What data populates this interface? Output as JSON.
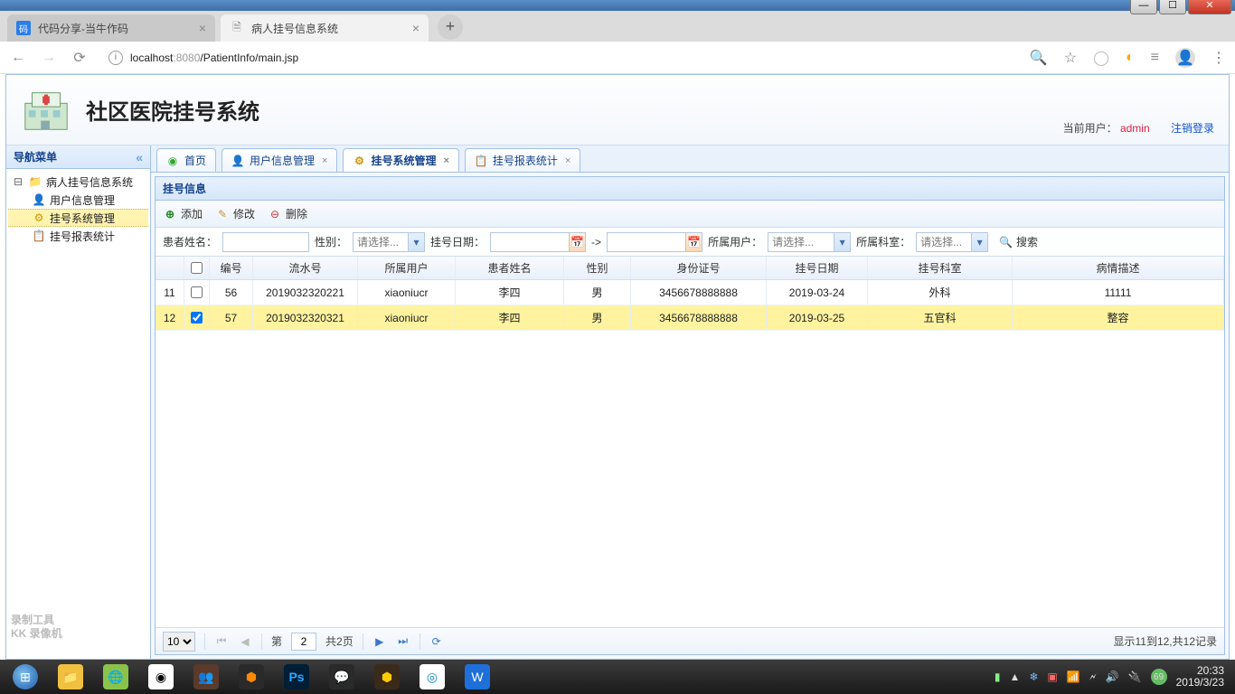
{
  "window": {
    "minimize": "—",
    "maximize": "☐",
    "close": "✕"
  },
  "browser": {
    "tabs": [
      {
        "title": "代码分享-当牛作码",
        "favicon_bg": "#2b7de9",
        "favicon_txt": "码",
        "active": false
      },
      {
        "title": "病人挂号信息系统",
        "favicon_bg": "#ffffff",
        "favicon_txt": "🗎",
        "active": true
      }
    ],
    "newtab": "+",
    "url_host": "localhost",
    "url_port": ":8080",
    "url_path": "/PatientInfo/main.jsp"
  },
  "header": {
    "title": "社区医院挂号系统",
    "current_user_label": "当前用户：",
    "current_user": "admin",
    "logout": "注销登录"
  },
  "sidebar": {
    "title": "导航菜单",
    "root": "病人挂号信息系统",
    "items": [
      {
        "label": "用户信息管理"
      },
      {
        "label": "挂号系统管理"
      },
      {
        "label": "挂号报表统计"
      }
    ]
  },
  "tabs": [
    {
      "label": "首页",
      "closable": false
    },
    {
      "label": "用户信息管理",
      "closable": true
    },
    {
      "label": "挂号系统管理",
      "closable": true,
      "active": true
    },
    {
      "label": "挂号报表统计",
      "closable": true
    }
  ],
  "panel": {
    "title": "挂号信息"
  },
  "toolbar": {
    "add": "添加",
    "edit": "修改",
    "del": "删除"
  },
  "search": {
    "name_label": "患者姓名：",
    "sex_label": "性别：",
    "sex_placeholder": "请选择...",
    "date_label": "挂号日期：",
    "date_sep": "->",
    "owner_label": "所属用户：",
    "owner_placeholder": "请选择...",
    "dept_label": "所属科室：",
    "dept_placeholder": "请选择...",
    "search_btn": "搜索"
  },
  "grid": {
    "headers": {
      "id": "编号",
      "serial": "流水号",
      "user": "所属用户",
      "name": "患者姓名",
      "sex": "性别",
      "idno": "身份证号",
      "date": "挂号日期",
      "dept": "挂号科室",
      "desc": "病情描述"
    },
    "rows": [
      {
        "rn": "11",
        "checked": false,
        "id": "56",
        "serial": "2019032320221",
        "user": "xiaoniucr",
        "name": "李四",
        "sex": "男",
        "idno": "3456678888888",
        "date": "2019-03-24",
        "dept": "外科",
        "desc": "11111"
      },
      {
        "rn": "12",
        "checked": true,
        "id": "57",
        "serial": "2019032320321",
        "user": "xiaoniucr",
        "name": "李四",
        "sex": "男",
        "idno": "3456678888888",
        "date": "2019-03-25",
        "dept": "五官科",
        "desc": "整容"
      }
    ]
  },
  "pager": {
    "pagesize": "10",
    "page_label_pre": "第",
    "page": "2",
    "page_label_post": "共2页",
    "info": "显示11到12,共12记录"
  },
  "watermark": {
    "line1": "录制工具",
    "line2": "KK 录像机"
  },
  "taskbar": {
    "time": "20:33",
    "date": "2019/3/23",
    "battery_badge": "69"
  }
}
